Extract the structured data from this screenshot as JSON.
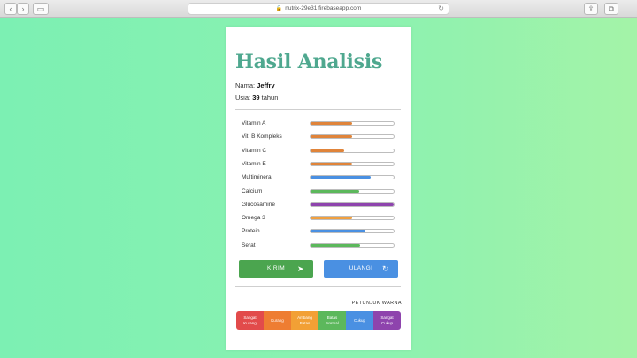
{
  "browser": {
    "url": "nutrix-29e31.firebaseapp.com",
    "back_glyph": "‹",
    "forward_glyph": "›",
    "sidebar_glyph": "▭",
    "share_glyph": "⇪",
    "tabs_glyph": "⧉",
    "reload_glyph": "↻",
    "lock_glyph": "🔒"
  },
  "card": {
    "title": "Hasil Analisis",
    "name_label": "Nama:",
    "name_value": "Jeffry",
    "age_label": "Usia:",
    "age_value": "39",
    "age_unit": "tahun"
  },
  "nutrients": [
    {
      "label": "Vitamin A",
      "level": 0.5,
      "color": "#e0843a"
    },
    {
      "label": "Vit. B Kompleks",
      "level": 0.5,
      "color": "#e0843a"
    },
    {
      "label": "Vitamin C",
      "level": 0.4,
      "color": "#e0843a"
    },
    {
      "label": "Vitamin E",
      "level": 0.5,
      "color": "#e0843a"
    },
    {
      "label": "Multimineral",
      "level": 0.72,
      "color": "#4a90e2"
    },
    {
      "label": "Calcium",
      "level": 0.58,
      "color": "#5cb85c"
    },
    {
      "label": "Glucosamine",
      "level": 1.0,
      "color": "#8e44ad"
    },
    {
      "label": "Omega 3",
      "level": 0.5,
      "color": "#f0a040"
    },
    {
      "label": "Protein",
      "level": 0.66,
      "color": "#4a90e2"
    },
    {
      "label": "Serat",
      "level": 0.6,
      "color": "#5cb85c"
    }
  ],
  "buttons": {
    "kirim_label": "KIRIM",
    "kirim_icon": "➤",
    "ulangi_label": "ULANGI",
    "ulangi_icon": "↻"
  },
  "legend": {
    "title": "PETUNJUK WARNA",
    "items": [
      {
        "label": "Sangat Kurang",
        "color": "#e24b4b"
      },
      {
        "label": "Kurang",
        "color": "#ee7d32"
      },
      {
        "label": "Ambang Batas",
        "color": "#f2a035"
      },
      {
        "label": "Batas Normal",
        "color": "#5cb85c"
      },
      {
        "label": "Cukup",
        "color": "#4a90e2"
      },
      {
        "label": "Sangat Cukup",
        "color": "#8e44ad"
      }
    ]
  }
}
